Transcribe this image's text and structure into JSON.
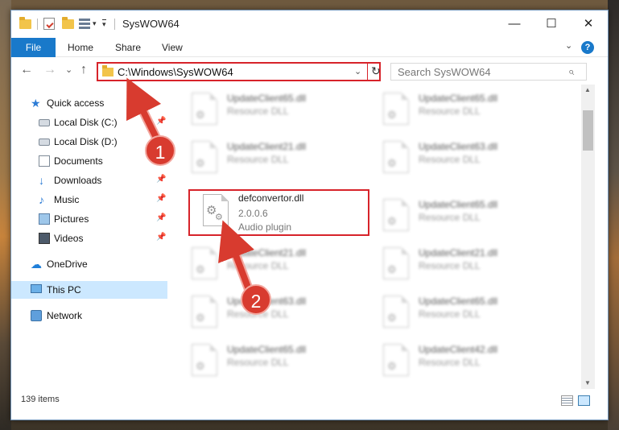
{
  "window": {
    "title": "SysWOW64",
    "min_glyph": "—",
    "max_glyph": "☐",
    "close_glyph": "✕"
  },
  "quick_access_toolbar": {
    "dropdown_glyph": "▾"
  },
  "ribbon": {
    "tabs": [
      "File",
      "Home",
      "Share",
      "View"
    ],
    "expand_glyph": "⌄",
    "help_glyph": "?"
  },
  "navigation": {
    "back_glyph": "←",
    "forward_glyph": "→",
    "recent_glyph": "⌄",
    "up_glyph": "↑",
    "address": "C:\\Windows\\SysWOW64",
    "address_dropdown_glyph": "⌄",
    "refresh_glyph": "↻",
    "search_placeholder": "Search SysWOW64",
    "search_glyph": "⌕"
  },
  "nav_pane": {
    "items": [
      {
        "label": "Quick access",
        "icon": "star-icon"
      },
      {
        "label": "Local Disk (C:)",
        "icon": "disk-icon",
        "pinned": true
      },
      {
        "label": "Local Disk (D:)",
        "icon": "disk-icon"
      },
      {
        "label": "Documents",
        "icon": "documents-icon",
        "pinned": true
      },
      {
        "label": "Downloads",
        "icon": "downloads-icon",
        "pinned": true
      },
      {
        "label": "Music",
        "icon": "music-icon",
        "pinned": true
      },
      {
        "label": "Pictures",
        "icon": "pictures-icon",
        "pinned": true
      },
      {
        "label": "Videos",
        "icon": "videos-icon",
        "pinned": true
      },
      {
        "label": "OneDrive",
        "icon": "onedrive-icon"
      },
      {
        "label": "This PC",
        "icon": "this-pc-icon",
        "selected": true
      },
      {
        "label": "Network",
        "icon": "network-icon"
      }
    ],
    "pin_glyph": "📌",
    "star_glyph": "★",
    "download_glyph": "↓",
    "music_glyph": "♪",
    "cloud_glyph": "☁"
  },
  "files": {
    "left_column": [
      {
        "name": "UpdateClient65.dll",
        "type": "Resource DLL"
      },
      {
        "name": "UpdateClient21.dll",
        "type": "Resource DLL"
      },
      {
        "name": "defconvertor.dll",
        "version": "2.0.0.6",
        "type": "Audio plugin",
        "highlighted": true
      },
      {
        "name": "UpdateClient21.dll",
        "type": "Resource DLL"
      },
      {
        "name": "UpdateClient63.dll",
        "type": "Resource DLL"
      },
      {
        "name": "UpdateClient65.dll",
        "type": "Resource DLL"
      }
    ],
    "right_column": [
      {
        "name": "UpdateClient65.dll",
        "type": "Resource DLL"
      },
      {
        "name": "UpdateClient63.dll",
        "type": "Resource DLL"
      },
      {
        "name": "UpdateClient65.dll",
        "type": "Resource DLL"
      },
      {
        "name": "UpdateClient21.dll",
        "type": "Resource DLL"
      },
      {
        "name": "UpdateClient65.dll",
        "type": "Resource DLL"
      },
      {
        "name": "UpdateClient42.dll",
        "type": "Resource DLL"
      }
    ],
    "gear_glyph": "⚙"
  },
  "scrollbar": {
    "up_glyph": "▲",
    "down_glyph": "▼"
  },
  "status_bar": {
    "item_count": "139 items"
  },
  "annotations": {
    "step1": "1",
    "step2": "2",
    "color": "#d83b2f"
  },
  "colors": {
    "accent": "#1979ca",
    "highlight_red": "#d7232a",
    "selection": "#cce8ff"
  }
}
